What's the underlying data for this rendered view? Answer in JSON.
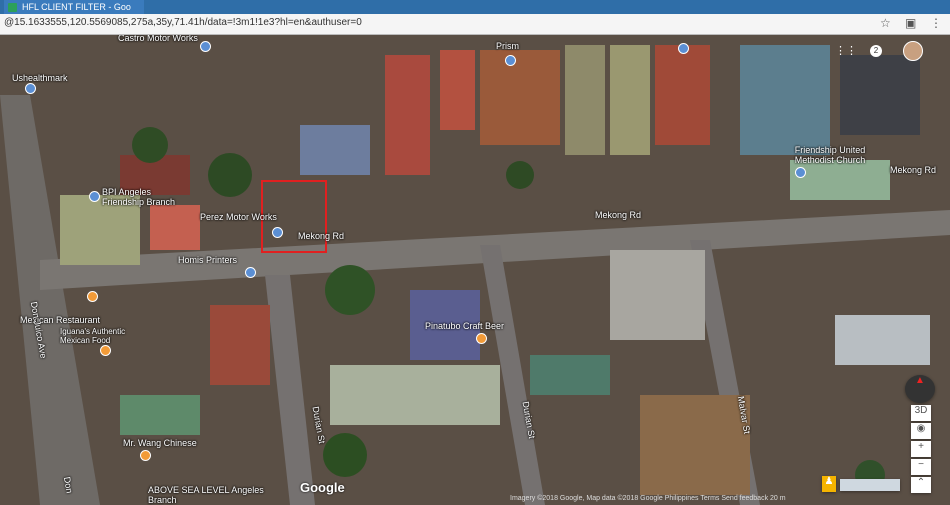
{
  "browser": {
    "tab_title": "HFL CLIENT FILTER - Goo",
    "url": "@15.1633555,120.5569085,275a,35y,71.41h/data=!3m1!1e3?hl=en&authuser=0",
    "star_icon": "star-icon",
    "extension_icon": "extension-icon",
    "menu_icon": "menu-icon"
  },
  "map": {
    "places": [
      "Castro Motor Works",
      "Ushealthmark",
      "Prism",
      "Friendship United Methodist Church",
      "BPI Angeles Friendship Branch",
      "Perez Motor Works",
      "Mekong Rd",
      "Mekong Rd",
      "Mekong Rd",
      "Homis Printers",
      "Pinatubo Craft Beer",
      "Mexican Restaurant",
      "Iguana's Authentic Mexican Food",
      "Mr. Wang Chinese",
      "ABOVE SEA LEVEL Angeles Branch",
      "Durian St",
      "Durian St",
      "Malvar St",
      "Don Juico Ave",
      "Don"
    ],
    "notification_count": "2",
    "google_logo": "Google",
    "footer": "Imagery ©2018 Google, Map data ©2018 Google   Philippines   Terms   Send feedback   20 m",
    "controls": {
      "view_3d": "3D",
      "zoom_in": "+",
      "zoom_out": "−",
      "expand": "⌃"
    }
  }
}
